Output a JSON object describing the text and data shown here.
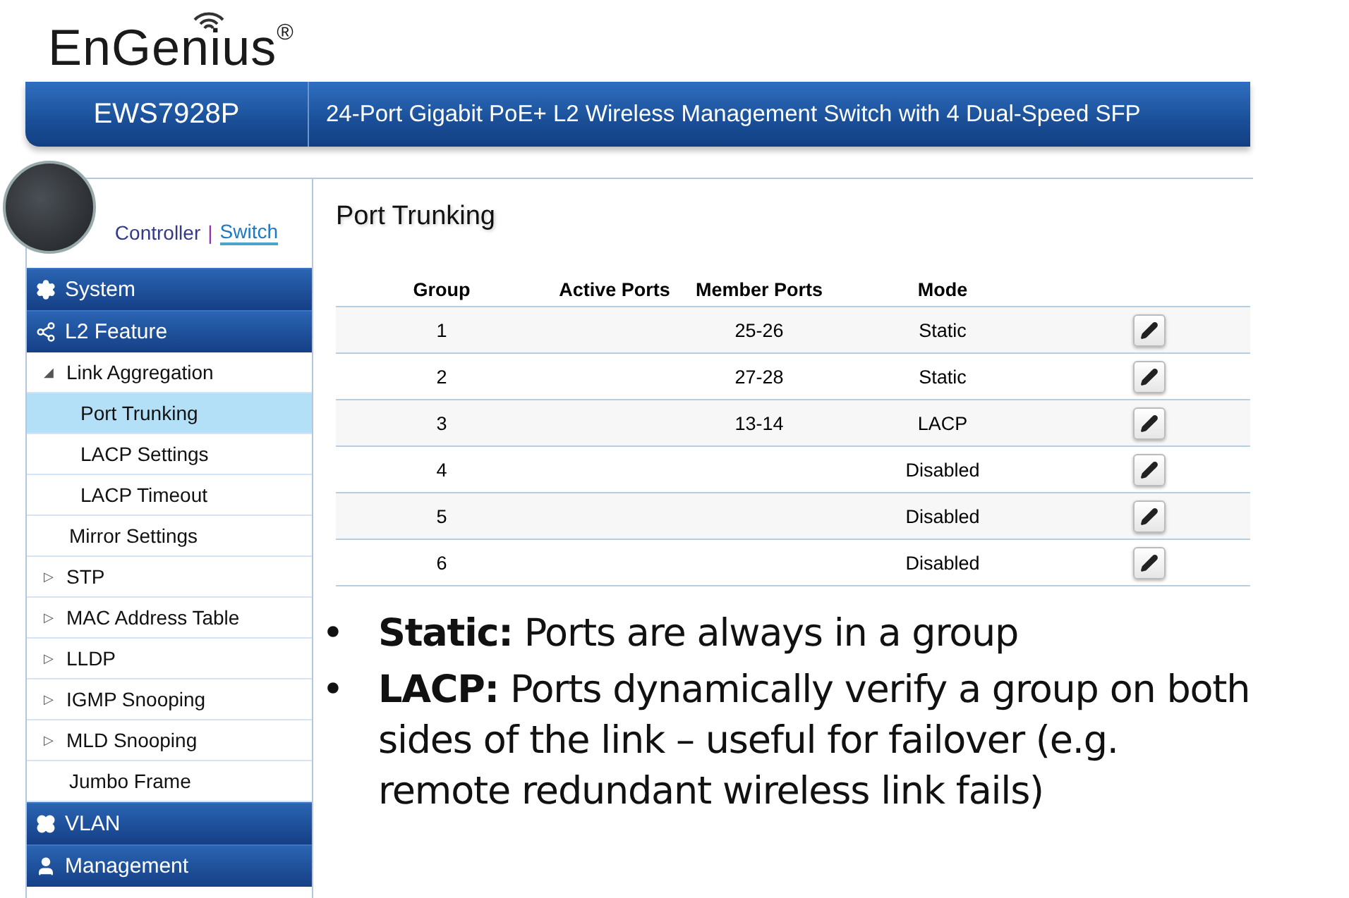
{
  "header": {
    "logo": "EnGenius",
    "logo_mark": "®",
    "model": "EWS7928P",
    "description": "24-Port Gigabit PoE+ L2 Wireless Management Switch with 4 Dual-Speed SFP"
  },
  "mode_switch": [
    {
      "label": "Controller",
      "selected": false
    },
    {
      "label": "Switch",
      "selected": true
    }
  ],
  "mode_separator": "|",
  "sidebar": {
    "items": [
      {
        "label": "System"
      },
      {
        "label": "L2 Feature",
        "children": [
          {
            "toggle": "◢",
            "label": "Link Aggregation",
            "selected": false,
            "children": [
              {
                "label": "Port Trunking",
                "selected": true
              },
              {
                "label": "LACP Settings",
                "selected": false
              },
              {
                "label": "LACP Timeout",
                "selected": false
              }
            ]
          },
          {
            "label": "Mirror Settings",
            "selected": false
          },
          {
            "toggle": "▷",
            "label": "STP",
            "selected": false
          },
          {
            "toggle": "▷",
            "label": "MAC Address Table",
            "selected": false
          },
          {
            "toggle": "▷",
            "label": "LLDP",
            "selected": false
          },
          {
            "toggle": "▷",
            "label": "IGMP Snooping",
            "selected": false
          },
          {
            "toggle": "▷",
            "label": "MLD Snooping",
            "selected": false
          },
          {
            "label": "Jumbo Frame",
            "selected": false
          }
        ]
      },
      {
        "label": "VLAN"
      },
      {
        "label": "Management"
      }
    ]
  },
  "page_title": "Port Trunking",
  "table": {
    "columns": [
      "Group",
      "Active Ports",
      "Member Ports",
      "Mode"
    ],
    "rows": [
      {
        "group": "1",
        "active_ports": "",
        "member_ports": "25-26",
        "mode": "Static"
      },
      {
        "group": "2",
        "active_ports": "",
        "member_ports": "27-28",
        "mode": "Static"
      },
      {
        "group": "3",
        "active_ports": "",
        "member_ports": "13-14",
        "mode": "LACP"
      },
      {
        "group": "4",
        "active_ports": "",
        "member_ports": "",
        "mode": "Disabled"
      },
      {
        "group": "5",
        "active_ports": "",
        "member_ports": "",
        "mode": "Disabled"
      },
      {
        "group": "6",
        "active_ports": "",
        "member_ports": "",
        "mode": "Disabled"
      }
    ]
  },
  "notes": [
    {
      "bullet": "•",
      "text": "**Static:**  Ports are always in a group"
    },
    {
      "bullet": "•",
      "text": "**LACP:**  Ports dynamically verify a group on both sides of the link – useful for failover (e.g. remote redundant wireless link fails)"
    }
  ]
}
